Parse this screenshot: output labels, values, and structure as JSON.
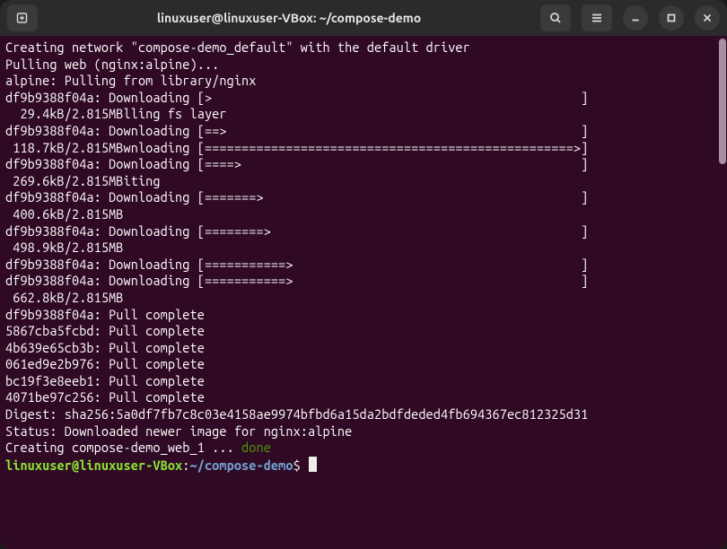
{
  "titlebar": {
    "title": "linuxuser@linuxuser-VBox: ~/compose-demo"
  },
  "terminal": {
    "lines": [
      "Creating network \"compose-demo_default\" with the default driver",
      "Pulling web (nginx:alpine)...",
      "alpine: Pulling from library/nginx",
      "df9b9388f04a: Downloading [>                                                  ]",
      "  29.4kB/2.815MBlling fs layer",
      "df9b9388f04a: Downloading [==>                                                ]",
      " 118.7kB/2.815MBwnloading [==================================================>]",
      "df9b9388f04a: Downloading [====>                                              ]",
      " 269.6kB/2.815MBiting",
      "df9b9388f04a: Downloading [=======>                                           ]",
      " 400.6kB/2.815MB",
      "df9b9388f04a: Downloading [========>                                          ]",
      " 498.9kB/2.815MB",
      "df9b9388f04a: Downloading [===========>                                       ]",
      "df9b9388f04a: Downloading [===========>                                       ]",
      " 662.8kB/2.815MB",
      "df9b9388f04a: Pull complete",
      "5867cba5fcbd: Pull complete",
      "4b639e65cb3b: Pull complete",
      "061ed9e2b976: Pull complete",
      "bc19f3e8eeb1: Pull complete",
      "4071be97c256: Pull complete",
      "Digest: sha256:5a0df7fb7c8c03e4158ae9974bfbd6a15da2bdfdeded4fb694367ec812325d31",
      "Status: Downloaded newer image for nginx:alpine"
    ],
    "creating_line_prefix": "Creating compose-demo_web_1 ... ",
    "creating_done": "done",
    "prompt": {
      "userhost": "linuxuser@linuxuser-VBox",
      "colon": ":",
      "cwd": "~/compose-demo",
      "dollar": "$ "
    }
  }
}
